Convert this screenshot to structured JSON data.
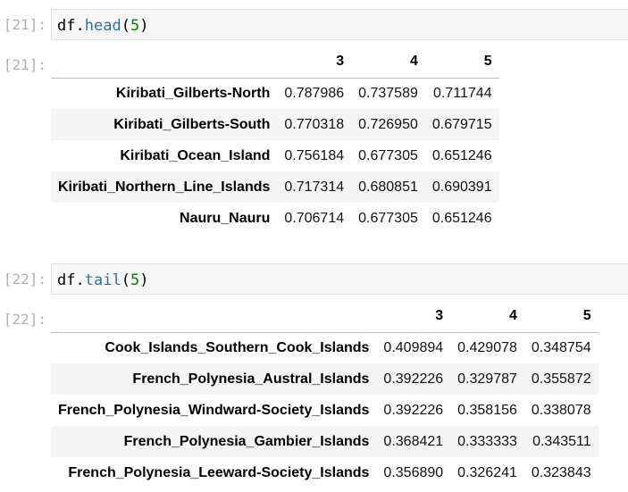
{
  "cells": [
    {
      "input_prompt": "[21]:",
      "output_prompt": "[21]:",
      "code": {
        "obj": "df",
        "dot": ".",
        "method": "head",
        "open": "(",
        "arg": "5",
        "close": ")"
      },
      "table": {
        "columns": [
          "",
          "3",
          "4",
          "5"
        ],
        "rows": [
          {
            "index": "Kiribati_Gilberts-North",
            "values": [
              "0.787986",
              "0.737589",
              "0.711744"
            ]
          },
          {
            "index": "Kiribati_Gilberts-South",
            "values": [
              "0.770318",
              "0.726950",
              "0.679715"
            ]
          },
          {
            "index": "Kiribati_Ocean_Island",
            "values": [
              "0.756184",
              "0.677305",
              "0.651246"
            ]
          },
          {
            "index": "Kiribati_Northern_Line_Islands",
            "values": [
              "0.717314",
              "0.680851",
              "0.690391"
            ]
          },
          {
            "index": "Nauru_Nauru",
            "values": [
              "0.706714",
              "0.677305",
              "0.651246"
            ]
          }
        ]
      }
    },
    {
      "input_prompt": "[22]:",
      "output_prompt": "[22]:",
      "code": {
        "obj": "df",
        "dot": ".",
        "method": "tail",
        "open": "(",
        "arg": "5",
        "close": ")"
      },
      "table": {
        "columns": [
          "",
          "3",
          "4",
          "5"
        ],
        "rows": [
          {
            "index": "Cook_Islands_Southern_Cook_Islands",
            "values": [
              "0.409894",
              "0.429078",
              "0.348754"
            ]
          },
          {
            "index": "French_Polynesia_Austral_Islands",
            "values": [
              "0.392226",
              "0.329787",
              "0.355872"
            ]
          },
          {
            "index": "French_Polynesia_Windward-Society_Islands",
            "values": [
              "0.392226",
              "0.358156",
              "0.338078"
            ]
          },
          {
            "index": "French_Polynesia_Gambier_Islands",
            "values": [
              "0.368421",
              "0.333333",
              "0.343511"
            ]
          },
          {
            "index": "French_Polynesia_Leeward-Society_Islands",
            "values": [
              "0.356890",
              "0.326241",
              "0.323843"
            ]
          }
        ]
      }
    }
  ],
  "colors": {
    "prompt": "#b0b0b0",
    "method": "#2f6f9f",
    "number": "#008000",
    "input_bg": "#f7f7f7"
  }
}
